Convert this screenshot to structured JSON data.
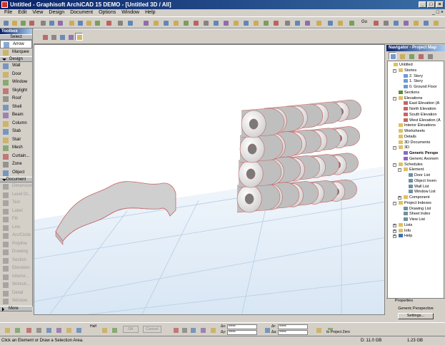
{
  "window": {
    "title": "Untitled - Graphisoft ArchiCAD 15 DEMO - [Untitled 3D / All]",
    "minimize": "_",
    "maximize": "□",
    "close": "×"
  },
  "menu": [
    "File",
    "Edit",
    "View",
    "Design",
    "Document",
    "Options",
    "Window",
    "Help"
  ],
  "toolbar": {
    "goto_label": "Go"
  },
  "toolbox": {
    "title": "Toolbox",
    "select_label": "Select",
    "sections": {
      "design": "Design",
      "document": "Document",
      "more": "More"
    },
    "select_tools": [
      "Arrow",
      "Marquee"
    ],
    "design_tools": [
      "Wall",
      "Door",
      "Window",
      "Skylight",
      "Roof",
      "Shell",
      "Beam",
      "Column",
      "Slab",
      "Stair",
      "Mesh",
      "Curtain...",
      "Zone",
      "Object"
    ],
    "document_tools": [
      "Dimension",
      "Level Di...",
      "Text",
      "Label",
      "Fill",
      "Line",
      "Arc/Circle",
      "Polyline",
      "Drawing",
      "Section",
      "Elevation",
      "Interior...",
      "Worksh...",
      "Detail",
      "Window"
    ]
  },
  "navigator": {
    "title": "Navigator - Project Map",
    "tree": [
      {
        "label": "Untitled",
        "level": 0,
        "icon": "folder-icon"
      },
      {
        "label": "Stories",
        "level": 1,
        "icon": "folder-icon",
        "exp": "-"
      },
      {
        "label": "2. Story",
        "level": 2,
        "icon": "story-icon"
      },
      {
        "label": "1. Story",
        "level": 2,
        "icon": "story-icon"
      },
      {
        "label": "0. Ground Floor",
        "level": 2,
        "icon": "story-icon"
      },
      {
        "label": "Sections",
        "level": 1,
        "icon": "section-icon"
      },
      {
        "label": "Elevations",
        "level": 1,
        "icon": "folder-icon",
        "exp": "-"
      },
      {
        "label": "East Elevation (A",
        "level": 2,
        "icon": "elevation-icon"
      },
      {
        "label": "North Elevation",
        "level": 2,
        "icon": "elevation-icon"
      },
      {
        "label": "South Elevation",
        "level": 2,
        "icon": "elevation-icon"
      },
      {
        "label": "West Elevation (A",
        "level": 2,
        "icon": "elevation-icon"
      },
      {
        "label": "Interior Elevations",
        "level": 1,
        "icon": "folder-icon"
      },
      {
        "label": "Worksheets",
        "level": 1,
        "icon": "folder-icon"
      },
      {
        "label": "Details",
        "level": 1,
        "icon": "folder-icon"
      },
      {
        "label": "3D Documents",
        "level": 1,
        "icon": "folder-icon"
      },
      {
        "label": "3D",
        "level": 1,
        "icon": "folder-icon",
        "exp": "-"
      },
      {
        "label": "Generic Perspe",
        "level": 2,
        "icon": "perspective-icon",
        "bold": true
      },
      {
        "label": "Generic Axonom",
        "level": 2,
        "icon": "axonometry-icon"
      },
      {
        "label": "Schedules",
        "level": 1,
        "icon": "folder-icon",
        "exp": "-"
      },
      {
        "label": "Element",
        "level": 2,
        "icon": "folder-icon",
        "exp": "-"
      },
      {
        "label": "Door List",
        "level": 3,
        "icon": "schedule-icon"
      },
      {
        "label": "Object Inven",
        "level": 3,
        "icon": "schedule-icon"
      },
      {
        "label": "Wall List",
        "level": 3,
        "icon": "schedule-icon"
      },
      {
        "label": "Window List",
        "level": 3,
        "icon": "schedule-icon"
      },
      {
        "label": "Component",
        "level": 2,
        "icon": "folder-icon",
        "exp": "+"
      },
      {
        "label": "Project Indexes",
        "level": 1,
        "icon": "folder-icon",
        "exp": "-"
      },
      {
        "label": "Drawing List",
        "level": 2,
        "icon": "schedule-icon"
      },
      {
        "label": "Sheet Index",
        "level": 2,
        "icon": "schedule-icon"
      },
      {
        "label": "View List",
        "level": 2,
        "icon": "schedule-icon"
      },
      {
        "label": "Lists",
        "level": 1,
        "icon": "folder-icon",
        "exp": "+"
      },
      {
        "label": "Info",
        "level": 1,
        "icon": "folder-icon",
        "exp": "+"
      },
      {
        "label": "Help",
        "level": 1,
        "icon": "help-icon",
        "exp": "+"
      }
    ]
  },
  "properties": {
    "title": "Properties",
    "view_name": "Generic Perspective",
    "settings_label": "Settings..."
  },
  "infobox": {
    "ok": "OK",
    "cancel": "Cancel",
    "half": "Half",
    "dx": "*****",
    "dy": "*****",
    "r": "*****",
    "a": "*****",
    "to_project_zero": "to Project Zero",
    "dx_label": "Δx:",
    "dy_label": "Δy:",
    "r_label": "Δr:",
    "a_label": "Δa:"
  },
  "status": {
    "message": "Click an Element or Draw a Selection Area.",
    "disk": "D: 11.0 GB",
    "ram": "1.23 GB"
  }
}
